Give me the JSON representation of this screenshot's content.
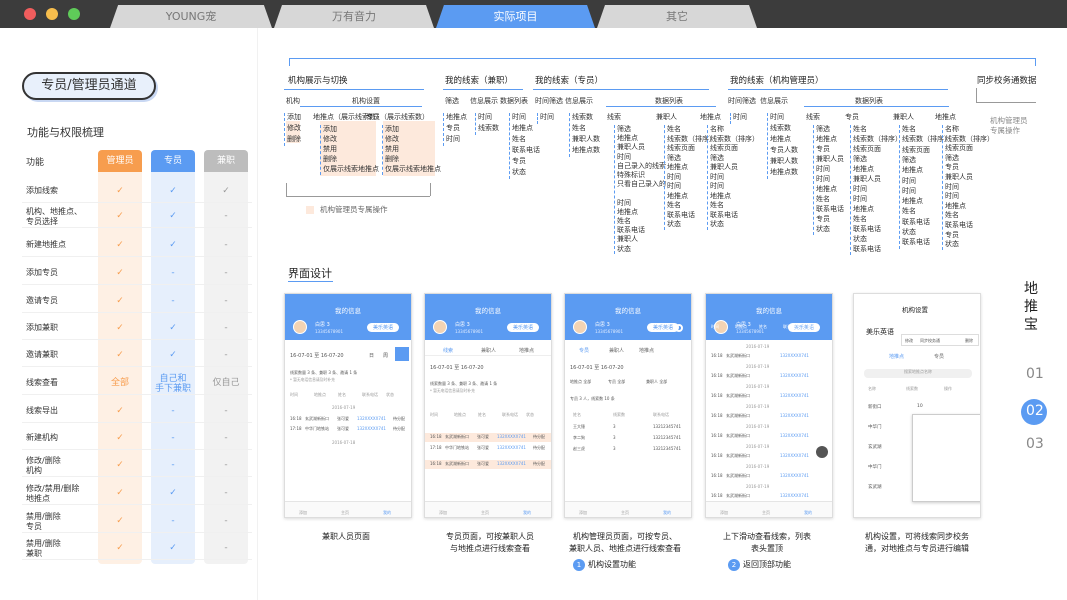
{
  "tabs": [
    {
      "label": "YOUNG宠"
    },
    {
      "label": "万有音力"
    },
    {
      "label": "实际项目"
    },
    {
      "label": "其它"
    }
  ],
  "left": {
    "pill": "专员/管理员通道",
    "title": "功能与权限梳理",
    "header_func": "功能",
    "cols": [
      "管理员",
      "专员",
      "兼职"
    ],
    "rows": [
      {
        "name": "添加线索",
        "v": [
          "✓",
          "✓",
          "✓"
        ]
      },
      {
        "name": "机构、地推点、\n专员选择",
        "v": [
          "✓",
          "✓",
          "-"
        ]
      },
      {
        "name": "新建地推点",
        "v": [
          "✓",
          "✓",
          "-"
        ]
      },
      {
        "name": "添加专员",
        "v": [
          "✓",
          "-",
          "-"
        ]
      },
      {
        "name": "邀请专员",
        "v": [
          "✓",
          "-",
          "-"
        ]
      },
      {
        "name": "添加兼职",
        "v": [
          "✓",
          "✓",
          "-"
        ]
      },
      {
        "name": "邀请兼职",
        "v": [
          "✓",
          "✓",
          "-"
        ]
      },
      {
        "name": "线索查看",
        "v": [
          "全部",
          "自己和\n手下兼职",
          "仅自己"
        ]
      },
      {
        "name": "线索导出",
        "v": [
          "✓",
          "-",
          "-"
        ]
      },
      {
        "name": "新建机构",
        "v": [
          "✓",
          "-",
          "-"
        ]
      },
      {
        "name": "修改/删除\n机构",
        "v": [
          "✓",
          "-",
          "-"
        ]
      },
      {
        "name": "修改/禁用/删除\n地推点",
        "v": [
          "✓",
          "✓",
          "-"
        ]
      },
      {
        "name": "禁用/删除\n专员",
        "v": [
          "✓",
          "-",
          "-"
        ]
      },
      {
        "name": "禁用/删除\n兼职",
        "v": [
          "✓",
          "✓",
          "-"
        ]
      }
    ]
  },
  "tree": {
    "sec1": "机构展示与切换",
    "sec2": "我的线索（兼职）",
    "sec3": "我的线索（专员）",
    "sec4": "我的线索（机构管理员）",
    "sec5": "同步校务通数据",
    "s1a": "机构",
    "s1b": "机构设置",
    "s1_jigou": [
      "添加",
      "修改",
      "删除"
    ],
    "s1_dtd": "地推点（展示线索数）",
    "s1_dtd_items": [
      "添加",
      "修改",
      "禁用",
      "删除",
      "仅展示线索地推点"
    ],
    "s1_zy": "专员（展示线索数）",
    "s1_zy_items": [
      "添加",
      "修改",
      "禁用",
      "删除",
      "仅展示线索地推点"
    ],
    "s1_note": "机构管理员专属操作",
    "s2_h": [
      "筛选",
      "信息展示",
      "数据列表"
    ],
    "s2_a": [
      "地推点",
      "专员",
      "时间"
    ],
    "s2_b": [
      "时间",
      "线索数"
    ],
    "s2_c": [
      "时间",
      "地推点",
      "姓名",
      "联系电话",
      "专员",
      "状态"
    ],
    "s3_h": [
      "时间筛选",
      "信息展示",
      "数据列表"
    ],
    "s3_a": [
      "时间"
    ],
    "s3_b": [
      "线索数",
      "姓名",
      "兼职人数",
      "地推点数"
    ],
    "s3_c1": "线索",
    "s3_c1_items": [
      "筛选",
      "地推点",
      "兼职人员",
      "时间",
      "自己录入的线索",
      "特殊标识",
      "只看自己录入的",
      "",
      "时间",
      "地推点",
      "姓名",
      "联系电话",
      "兼职人",
      "状态"
    ],
    "s3_c2": "兼职人",
    "s3_c2_items": [
      "姓名",
      "线索数（排序）",
      "线索页面",
      "筛选",
      "地推点",
      "时间",
      "时间",
      "地推点",
      "姓名",
      "联系电话",
      "状态"
    ],
    "s3_c3": "地推点",
    "s3_c3_items": [
      "名称",
      "线索数（排序）",
      "线索页面",
      "筛选",
      "兼职人员",
      "时间",
      "时间",
      "地推点",
      "姓名",
      "联系电话",
      "状态"
    ],
    "s4_h": [
      "时间筛选",
      "信息展示",
      "数据列表"
    ],
    "s4_a": [
      "时间"
    ],
    "s4_b": [
      "时间",
      "线索数",
      "地推点",
      "专员人数",
      "兼职人数",
      "地推点数"
    ],
    "s4_c1": "线索",
    "s4_c1_items": [
      "筛选",
      "地推点",
      "专员",
      "兼职人员",
      "时间",
      "时间",
      "地推点",
      "姓名",
      "联系电话",
      "专员",
      "状态"
    ],
    "s4_c2": "专员",
    "s4_c2_items": [
      "姓名",
      "线索数（排序）",
      "线索页面",
      "筛选",
      "地推点",
      "兼职人员",
      "时间",
      "时间",
      "地推点",
      "姓名",
      "联系电话",
      "状态",
      "联系电话"
    ],
    "s4_c3": "兼职人",
    "s4_c3_items": [
      "姓名",
      "线索数（排序）",
      "线索页面",
      "筛选",
      "地推点",
      "时间",
      "时间",
      "地推点",
      "姓名",
      "联系电话",
      "状态",
      "联系电话"
    ],
    "s4_c4": "地推点",
    "s4_c4_items": [
      "名称",
      "线索数（排序）",
      "线索页面",
      "筛选",
      "专员",
      "兼职人员",
      "时间",
      "时间",
      "地推点",
      "姓名",
      "联系电话",
      "专员",
      "状态"
    ],
    "s5_note": "机构管理员\n专属操作"
  },
  "design_title": "界面设计",
  "phones": {
    "my_info": "我的信息",
    "user": "白思 3",
    "phone_no": "13345678901",
    "org": "美乐英语",
    "date_range": "16-07-01 至 16-07-20",
    "period": [
      "日",
      "周",
      "月"
    ],
    "stats": "线索数量 3 条、兼职 3 条、邀请 1 条",
    "stats_note": "* 暂无电话信息请及时补充",
    "cols": [
      "时间",
      "地推点",
      "姓名",
      "联系电话",
      "状态"
    ],
    "date1": "2016-07-19",
    "date2": "2016-07-18",
    "row_time1": "16:18",
    "row_time2": "17:18",
    "row_place1": "玄武湖新街口",
    "row_place2": "中华门地铁站",
    "row_name": "张可爱",
    "row_phone": "132XXXXX741",
    "row_status": "待分配",
    "tabs_zy": [
      "线索",
      "兼职人",
      "地推点"
    ],
    "tabs_org": [
      "专员",
      "兼职人",
      "地推点"
    ],
    "filter": [
      "地推点 全部",
      "专员 全部",
      "兼职人 全部"
    ],
    "mid_cols": [
      "姓名",
      "线索数",
      "联系电话"
    ],
    "mid_rows": [
      [
        "王大锤",
        "3",
        "13212345741"
      ],
      [
        "李二狗",
        "3",
        "13212345741"
      ],
      [
        "赵三虎",
        "3",
        "13212345741"
      ]
    ],
    "stats2": "专员 3 人，线索数 10 条",
    "settings_title": "机构设置",
    "settings_org": "美乐英语",
    "settings_menu": [
      "修改",
      "同步校务通",
      "删除"
    ],
    "settings_tabs": [
      "地推点",
      "专员"
    ],
    "settings_search": "搜索地推点名称",
    "settings_cols": [
      "名称",
      "线索数",
      "操作"
    ],
    "settings_rows": [
      [
        "新街口",
        "10"
      ],
      [
        "中华门",
        ""
      ],
      [
        "玄武湖",
        ""
      ],
      [
        "中华门",
        ""
      ],
      [
        "玄武湖",
        ""
      ]
    ],
    "bottom_tabs": [
      "添加",
      "主页",
      "我的"
    ]
  },
  "captions": {
    "c1": "兼职人员页面",
    "c2": "专员页面，可按兼职人员\n与地推点进行线索查看",
    "c3": "机构管理员页面，可按专员、\n兼职人员、地推点进行线索查看",
    "c4": "上下滑动查看线索，列表\n表头置顶",
    "c5": "机构设置，可将线索同步校务\n通，对地推点与专员进行编辑",
    "n1": "机构设置功能",
    "n2": "返回顶部功能"
  },
  "side": {
    "title": "地\n推\n宝",
    "nums": [
      "01",
      "02",
      "03"
    ]
  },
  "colors": {
    "accent": "#5b9bf2",
    "admin": "#f79d4e",
    "staff": "#5b9bf2",
    "parttime": "#bdbdbd"
  }
}
